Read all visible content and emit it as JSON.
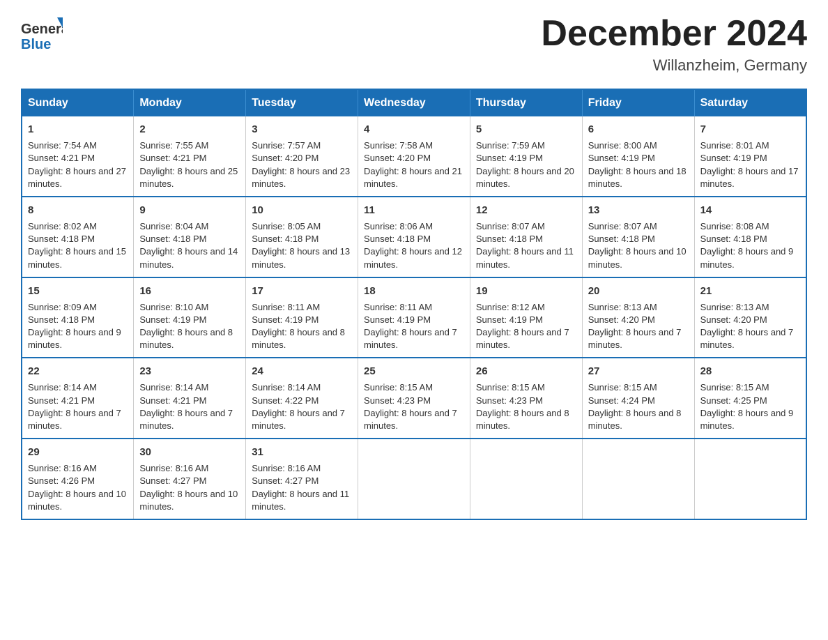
{
  "header": {
    "logo_general": "General",
    "logo_blue": "Blue",
    "month_title": "December 2024",
    "location": "Willanzheim, Germany"
  },
  "weekdays": [
    "Sunday",
    "Monday",
    "Tuesday",
    "Wednesday",
    "Thursday",
    "Friday",
    "Saturday"
  ],
  "weeks": [
    [
      {
        "day": "1",
        "sunrise": "Sunrise: 7:54 AM",
        "sunset": "Sunset: 4:21 PM",
        "daylight": "Daylight: 8 hours and 27 minutes."
      },
      {
        "day": "2",
        "sunrise": "Sunrise: 7:55 AM",
        "sunset": "Sunset: 4:21 PM",
        "daylight": "Daylight: 8 hours and 25 minutes."
      },
      {
        "day": "3",
        "sunrise": "Sunrise: 7:57 AM",
        "sunset": "Sunset: 4:20 PM",
        "daylight": "Daylight: 8 hours and 23 minutes."
      },
      {
        "day": "4",
        "sunrise": "Sunrise: 7:58 AM",
        "sunset": "Sunset: 4:20 PM",
        "daylight": "Daylight: 8 hours and 21 minutes."
      },
      {
        "day": "5",
        "sunrise": "Sunrise: 7:59 AM",
        "sunset": "Sunset: 4:19 PM",
        "daylight": "Daylight: 8 hours and 20 minutes."
      },
      {
        "day": "6",
        "sunrise": "Sunrise: 8:00 AM",
        "sunset": "Sunset: 4:19 PM",
        "daylight": "Daylight: 8 hours and 18 minutes."
      },
      {
        "day": "7",
        "sunrise": "Sunrise: 8:01 AM",
        "sunset": "Sunset: 4:19 PM",
        "daylight": "Daylight: 8 hours and 17 minutes."
      }
    ],
    [
      {
        "day": "8",
        "sunrise": "Sunrise: 8:02 AM",
        "sunset": "Sunset: 4:18 PM",
        "daylight": "Daylight: 8 hours and 15 minutes."
      },
      {
        "day": "9",
        "sunrise": "Sunrise: 8:04 AM",
        "sunset": "Sunset: 4:18 PM",
        "daylight": "Daylight: 8 hours and 14 minutes."
      },
      {
        "day": "10",
        "sunrise": "Sunrise: 8:05 AM",
        "sunset": "Sunset: 4:18 PM",
        "daylight": "Daylight: 8 hours and 13 minutes."
      },
      {
        "day": "11",
        "sunrise": "Sunrise: 8:06 AM",
        "sunset": "Sunset: 4:18 PM",
        "daylight": "Daylight: 8 hours and 12 minutes."
      },
      {
        "day": "12",
        "sunrise": "Sunrise: 8:07 AM",
        "sunset": "Sunset: 4:18 PM",
        "daylight": "Daylight: 8 hours and 11 minutes."
      },
      {
        "day": "13",
        "sunrise": "Sunrise: 8:07 AM",
        "sunset": "Sunset: 4:18 PM",
        "daylight": "Daylight: 8 hours and 10 minutes."
      },
      {
        "day": "14",
        "sunrise": "Sunrise: 8:08 AM",
        "sunset": "Sunset: 4:18 PM",
        "daylight": "Daylight: 8 hours and 9 minutes."
      }
    ],
    [
      {
        "day": "15",
        "sunrise": "Sunrise: 8:09 AM",
        "sunset": "Sunset: 4:18 PM",
        "daylight": "Daylight: 8 hours and 9 minutes."
      },
      {
        "day": "16",
        "sunrise": "Sunrise: 8:10 AM",
        "sunset": "Sunset: 4:19 PM",
        "daylight": "Daylight: 8 hours and 8 minutes."
      },
      {
        "day": "17",
        "sunrise": "Sunrise: 8:11 AM",
        "sunset": "Sunset: 4:19 PM",
        "daylight": "Daylight: 8 hours and 8 minutes."
      },
      {
        "day": "18",
        "sunrise": "Sunrise: 8:11 AM",
        "sunset": "Sunset: 4:19 PM",
        "daylight": "Daylight: 8 hours and 7 minutes."
      },
      {
        "day": "19",
        "sunrise": "Sunrise: 8:12 AM",
        "sunset": "Sunset: 4:19 PM",
        "daylight": "Daylight: 8 hours and 7 minutes."
      },
      {
        "day": "20",
        "sunrise": "Sunrise: 8:13 AM",
        "sunset": "Sunset: 4:20 PM",
        "daylight": "Daylight: 8 hours and 7 minutes."
      },
      {
        "day": "21",
        "sunrise": "Sunrise: 8:13 AM",
        "sunset": "Sunset: 4:20 PM",
        "daylight": "Daylight: 8 hours and 7 minutes."
      }
    ],
    [
      {
        "day": "22",
        "sunrise": "Sunrise: 8:14 AM",
        "sunset": "Sunset: 4:21 PM",
        "daylight": "Daylight: 8 hours and 7 minutes."
      },
      {
        "day": "23",
        "sunrise": "Sunrise: 8:14 AM",
        "sunset": "Sunset: 4:21 PM",
        "daylight": "Daylight: 8 hours and 7 minutes."
      },
      {
        "day": "24",
        "sunrise": "Sunrise: 8:14 AM",
        "sunset": "Sunset: 4:22 PM",
        "daylight": "Daylight: 8 hours and 7 minutes."
      },
      {
        "day": "25",
        "sunrise": "Sunrise: 8:15 AM",
        "sunset": "Sunset: 4:23 PM",
        "daylight": "Daylight: 8 hours and 7 minutes."
      },
      {
        "day": "26",
        "sunrise": "Sunrise: 8:15 AM",
        "sunset": "Sunset: 4:23 PM",
        "daylight": "Daylight: 8 hours and 8 minutes."
      },
      {
        "day": "27",
        "sunrise": "Sunrise: 8:15 AM",
        "sunset": "Sunset: 4:24 PM",
        "daylight": "Daylight: 8 hours and 8 minutes."
      },
      {
        "day": "28",
        "sunrise": "Sunrise: 8:15 AM",
        "sunset": "Sunset: 4:25 PM",
        "daylight": "Daylight: 8 hours and 9 minutes."
      }
    ],
    [
      {
        "day": "29",
        "sunrise": "Sunrise: 8:16 AM",
        "sunset": "Sunset: 4:26 PM",
        "daylight": "Daylight: 8 hours and 10 minutes."
      },
      {
        "day": "30",
        "sunrise": "Sunrise: 8:16 AM",
        "sunset": "Sunset: 4:27 PM",
        "daylight": "Daylight: 8 hours and 10 minutes."
      },
      {
        "day": "31",
        "sunrise": "Sunrise: 8:16 AM",
        "sunset": "Sunset: 4:27 PM",
        "daylight": "Daylight: 8 hours and 11 minutes."
      },
      null,
      null,
      null,
      null
    ]
  ]
}
